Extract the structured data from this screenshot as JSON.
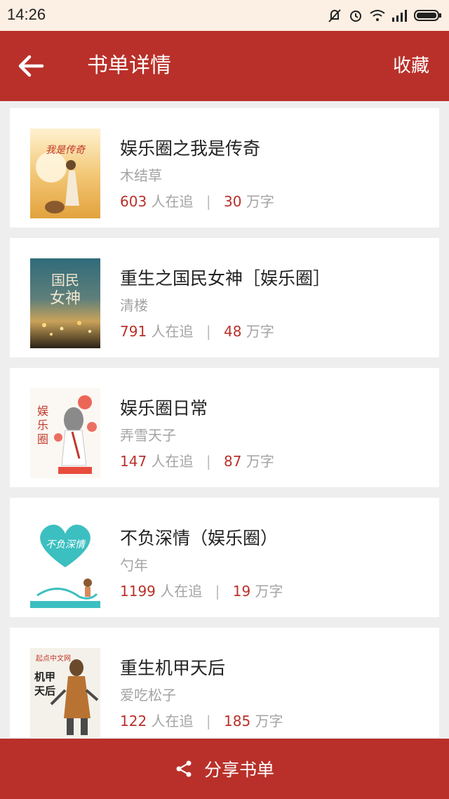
{
  "status_bar": {
    "time": "14:26",
    "icons": [
      "mute-icon",
      "alarm-icon",
      "wifi-icon",
      "signal-icon",
      "battery-icon"
    ]
  },
  "header": {
    "back_icon": "arrow-left-icon",
    "title": "书单详情",
    "collect_label": "收藏"
  },
  "books": [
    {
      "title": "娱乐圈之我是传奇",
      "author": "木结草",
      "followers": "603",
      "followers_suffix": "人在追",
      "words": "30",
      "words_suffix": "万字"
    },
    {
      "title": "重生之国民女神［娱乐圈］",
      "author": "清楼",
      "followers": "791",
      "followers_suffix": "人在追",
      "words": "48",
      "words_suffix": "万字"
    },
    {
      "title": "娱乐圈日常",
      "author": "弄雪天子",
      "followers": "147",
      "followers_suffix": "人在追",
      "words": "87",
      "words_suffix": "万字"
    },
    {
      "title": "不负深情（娱乐圈）",
      "author": "勺年",
      "followers": "1199",
      "followers_suffix": "人在追",
      "words": "19",
      "words_suffix": "万字"
    },
    {
      "title": "重生机甲天后",
      "author": "爱吃松子",
      "followers": "122",
      "followers_suffix": "人在追",
      "words": "185",
      "words_suffix": "万字"
    }
  ],
  "footer": {
    "share_icon": "share-icon",
    "share_label": "分享书单"
  },
  "colors": {
    "primary": "#b9302a",
    "status_bar_bg": "#fcefe3",
    "page_bg": "#eeeeee",
    "muted_text": "#a3a3a3"
  }
}
